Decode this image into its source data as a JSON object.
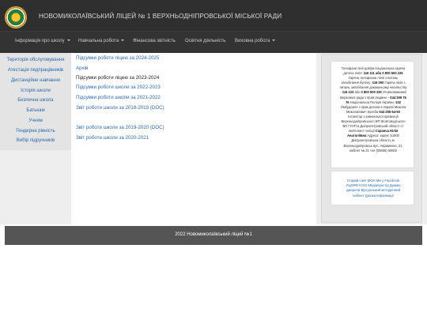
{
  "header": {
    "title": "НОВОМИКОЛАЇВСЬКИЙ ЛІЦЕЙ № 1 ВЕРХНЬОДНІПРОВСЬКОЇ МІСЬКОЇ РАДИ",
    "logo_icon": "school-emblem-icon"
  },
  "nav": {
    "items": [
      {
        "label": "Інформація про школу",
        "dropdown": true
      },
      {
        "label": "Навчальна робота",
        "dropdown": true
      },
      {
        "label": "Фінансова звітність",
        "dropdown": false
      },
      {
        "label": "Освітня діяльність",
        "dropdown": false
      },
      {
        "label": "Виховна робота",
        "dropdown": true
      }
    ]
  },
  "sidebar": {
    "items": [
      {
        "label": "Територія обслуговування"
      },
      {
        "label": "Атестація педпрацівників"
      },
      {
        "label": "Дистанційне навчання"
      },
      {
        "label": "Історія школи"
      },
      {
        "label": "Безпечна школа"
      },
      {
        "label": "Батькам"
      },
      {
        "label": "Учням"
      },
      {
        "label": "Гендерна рівність"
      },
      {
        "label": "Вибір підручників"
      }
    ]
  },
  "main": {
    "links": [
      {
        "label": "Підсумки роботи ліцею за 2024-2025"
      },
      {
        "label": "Архів"
      },
      {
        "label": "Підсумки роботи ліцею за 2023-2024"
      },
      {
        "label": "Підсумки роботи школи за 2022-2023"
      },
      {
        "label": "Підсумки роботи школи за 2021-2022"
      },
      {
        "label": "Звіт роботи школи за 2018-2019 (DOC)"
      },
      {
        "label": "Звіт роботи школи за 2019-2020 (DOC)"
      },
      {
        "label": "Звіт роботи школи за 2020-2021"
      }
    ]
  },
  "info": {
    "line1": "Телефони лінії довіри Національна гаряча",
    "line2": "дитяча лінія: ",
    "line2b": "116 111 або 0 800 500 225",
    "line3": "Гаряча телефонна лінія з питань",
    "line4": "запобігання булінгу -",
    "line4b": "116 000",
    "line4c": " Гаряча лінія з",
    "line5": "питань запобігання домашньому насильству",
    "line6a": "- ",
    "line6b": "116 123",
    "line6c": " або ",
    "line6d": "0 800 500 335",
    "line6e": " Уповноважений",
    "line7": "Верховної ради з прав людини –",
    "line7b": " 044 299 76",
    "line8b": "76",
    "line8": " Національна Поліція України -",
    "line8c": "102",
    "line9": "Омбудсмен з прав дитини в Україні Микола",
    "line10": "Миколайович Кулеба ",
    "line10b": "044 255-64-50",
    "line11": "Інспектор з ювенальної превенції",
    "line12": "Верхньодніпровського ВП Жовтоводського",
    "line13": "ВП ГУНП в Дніпропетровській області ст",
    "line14": "лейтенант поліції ",
    "line14b": "Саранча Юлія",
    "line15b": "Анатоліївна",
    "line15": " Адреса: індекс 51600",
    "line16": "Дніпропетровська область м.",
    "line17": "Верхньодніпровськ вул. Авраменко, 21,",
    "line18": "кабінет № 21 тел (05658) 60602"
  },
  "links_box": {
    "line1": "Старий сайт МОН Ми у Facebook",
    "line2": "УЦОЯО ІСУО Медіапростір Думаю",
    "line3": "джерела Віртуальний методичний",
    "line4": "кабінет Дошка інформації"
  },
  "footer": {
    "text": "2022 Новомиколаївський ліцей №1"
  },
  "colors": {
    "header_bg": "#2f2f2f",
    "navbar_bg": "#333333",
    "link": "#2a6ab0",
    "footer_bg": "#555555"
  }
}
